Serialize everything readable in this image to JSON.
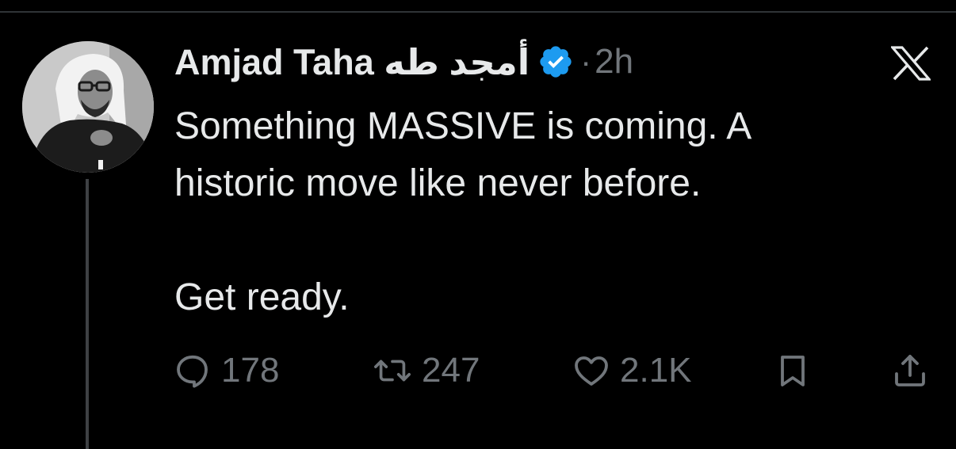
{
  "tweet": {
    "author_name": "Amjad Taha أمجد طه",
    "verified": true,
    "separator": "·",
    "time": "2h",
    "text": "Something MASSIVE is coming. A\nhistoric move like never before.\n\nGet ready."
  },
  "actions": {
    "replies": "178",
    "retweets": "247",
    "likes": "2.1K"
  },
  "colors": {
    "background": "#000000",
    "text": "#e7e9ea",
    "muted": "#71767b",
    "verified_badge": "#1d9bf0",
    "divider": "#2f3336"
  },
  "icons": {
    "reply": "speech-bubble-icon",
    "retweet": "retweet-arrows-icon",
    "like": "heart-icon",
    "bookmark": "bookmark-icon",
    "share": "share-upload-icon",
    "brand": "x-logo-icon",
    "verified": "verified-badge-icon"
  }
}
